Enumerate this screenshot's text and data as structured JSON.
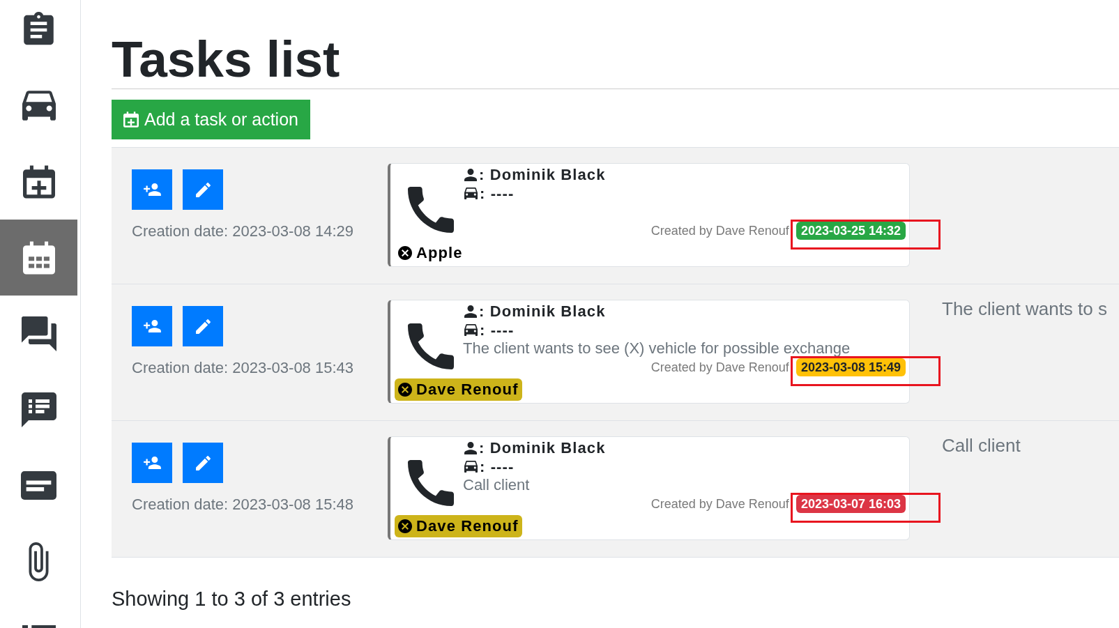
{
  "sidebar": {
    "items": [
      {
        "selected": false
      },
      {
        "selected": false
      },
      {
        "selected": false
      },
      {
        "selected": true
      },
      {
        "selected": false
      },
      {
        "selected": false
      },
      {
        "selected": false
      },
      {
        "selected": false
      },
      {
        "selected": false
      }
    ]
  },
  "page_title": "Tasks list",
  "add_button": {
    "label": "Add a task or action"
  },
  "tasks": [
    {
      "creation_date": "Creation date: 2023-03-08 14:29",
      "contact": ": Dominik Black",
      "vehicle": ": ----",
      "created_by": "Created by Dave Renouf",
      "due": {
        "text": "2023-03-25 14:32",
        "color": "#28a745"
      },
      "annotated": true,
      "assignee": {
        "label": "Apple"
      }
    },
    {
      "creation_date": "Creation date: 2023-03-08 15:43",
      "contact": ": Dominik Black",
      "vehicle": ": ----",
      "description": "The client wants to see (X) vehicle for possible exchange",
      "created_by": "Created by Dave Renouf",
      "due": {
        "text": "2023-03-08 15:49",
        "color": "#ffc107"
      },
      "annotated": true,
      "assignee": {
        "label": "Dave Renouf",
        "color": "#cdb41a"
      },
      "note": "The client wants to s"
    },
    {
      "creation_date": "Creation date: 2023-03-08 15:48",
      "contact": ": Dominik Black",
      "vehicle": ": ----",
      "description": "Call client",
      "created_by": "Created by Dave Renouf",
      "due": {
        "text": "2023-03-07 16:03",
        "color": "#dc3545"
      },
      "annotated": true,
      "assignee": {
        "label": "Dave Renouf",
        "color": "#cdb41a"
      },
      "note": "Call client"
    }
  ],
  "footer": "Showing 1 to 3 of 3 entries"
}
